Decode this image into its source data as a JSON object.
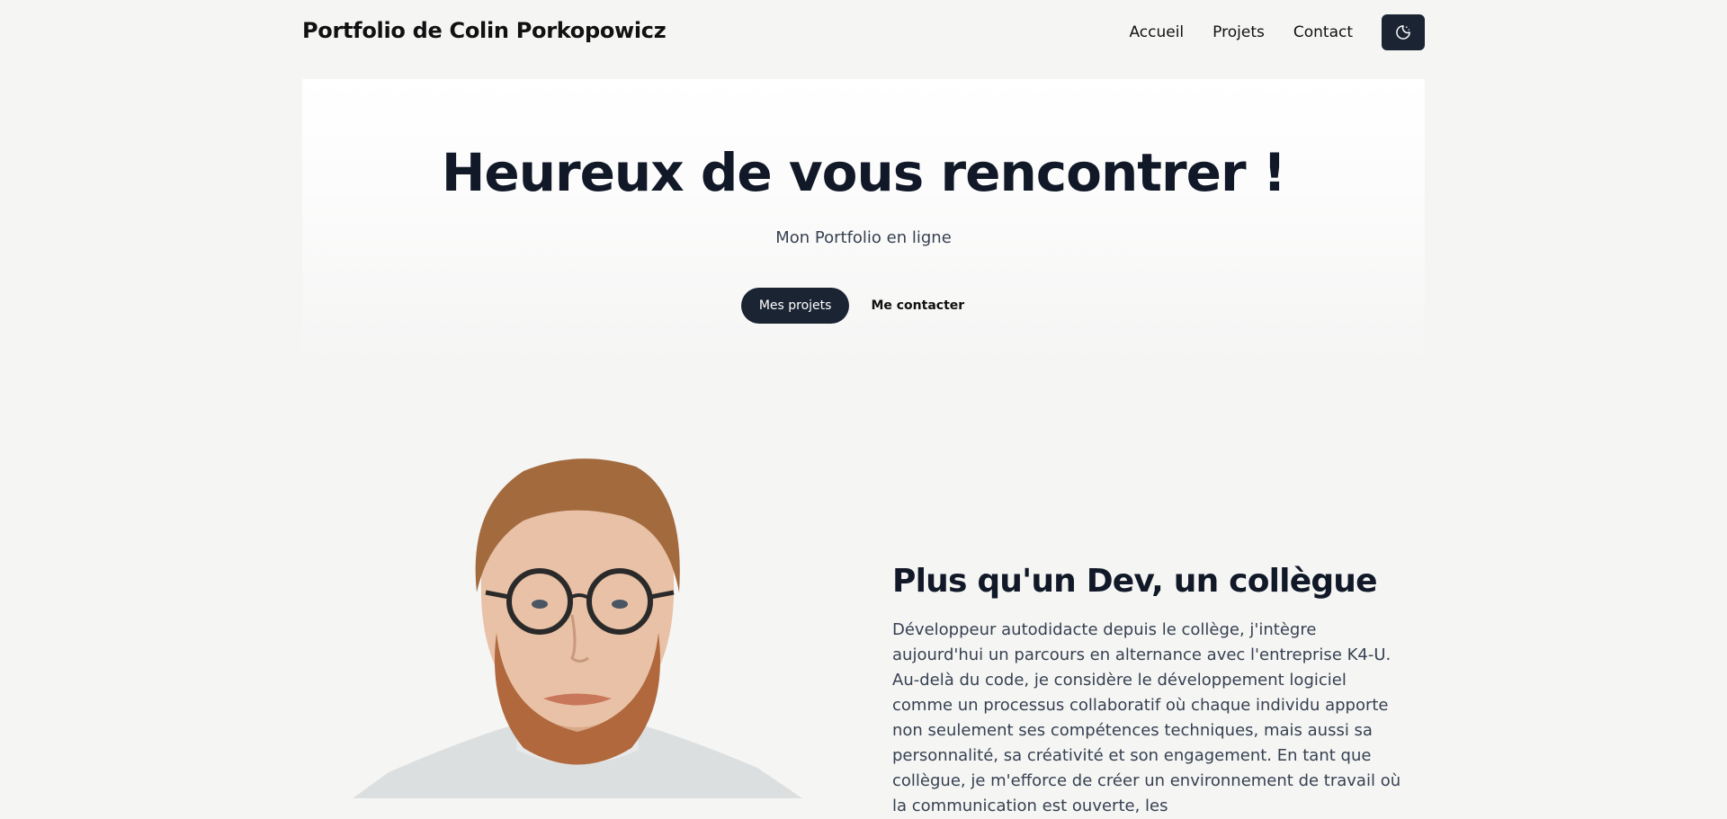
{
  "header": {
    "brand": "Portfolio de Colin Porkopowicz",
    "nav": {
      "home": "Accueil",
      "projects": "Projets",
      "contact": "Contact"
    },
    "theme_toggle_icon": "moon-icon"
  },
  "hero": {
    "title": "Heureux de vous rencontrer !",
    "subtitle": "Mon Portfolio en ligne",
    "primary_button": "Mes projets",
    "secondary_button": "Me contacter"
  },
  "about": {
    "title": "Plus qu'un Dev, un collègue",
    "text": "Développeur autodidacte depuis le collège, j'intègre aujourd'hui un parcours en alternance avec l'entreprise K4-U. Au-delà du code, je considère le développement logiciel comme un processus collaboratif où chaque individu apporte non seulement ses compétences techniques, mais aussi sa personnalité, sa créativité et son engagement. En tant que collègue, je m'efforce de créer un environnement de travail où la communication est ouverte, les"
  },
  "colors": {
    "page_background": "#f5f5f4",
    "dark_accent": "#1b2432",
    "heading": "#111827",
    "body_text": "#374151"
  }
}
